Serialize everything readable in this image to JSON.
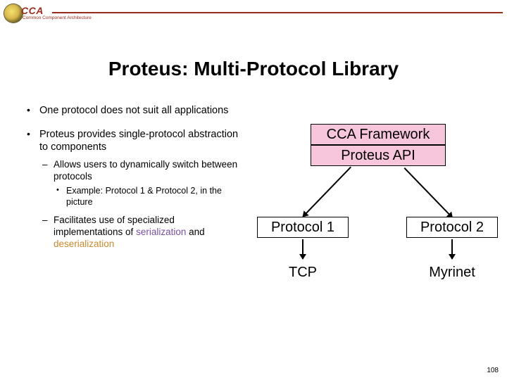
{
  "header": {
    "brand": "CCA",
    "subtitle": "Common Component Architecture"
  },
  "title": "Proteus: Multi-Protocol Library",
  "bullets": {
    "b1": "One protocol does not suit all applications",
    "b2": "Proteus provides single-protocol abstraction to components",
    "b2a": "Allows users to dynamically switch between protocols",
    "b2a1": "Example: Protocol 1 & Protocol 2, in the picture",
    "b2b_pre": "Facilitates use of specialized implementations of ",
    "b2b_ser": "serialization",
    "b2b_mid": " and ",
    "b2b_deser": "deserialization"
  },
  "diagram": {
    "framework": "CCA Framework",
    "api": "Proteus API",
    "proto1": "Protocol 1",
    "proto2": "Protocol 2",
    "net1": "TCP",
    "net2": "Myrinet"
  },
  "page_number": "108"
}
